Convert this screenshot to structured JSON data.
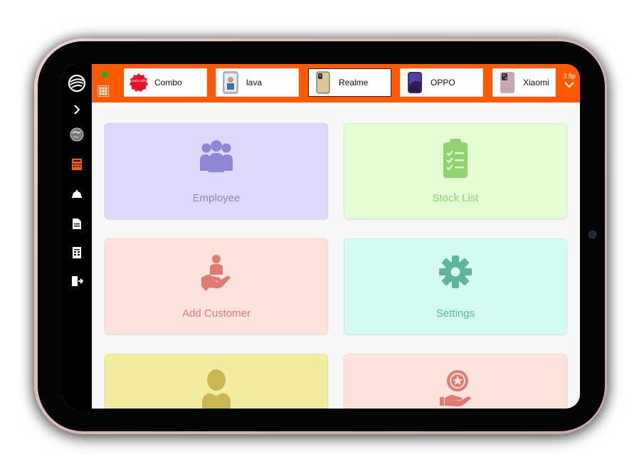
{
  "colors": {
    "topbar": "#ff5a00",
    "sidebar": "#000000",
    "status_online": "#22aa22"
  },
  "sidebar": {
    "items": [
      {
        "icon": "app-logo-icon"
      },
      {
        "icon": "chevron-right-icon"
      },
      {
        "icon": "globe-icon"
      },
      {
        "icon": "cash-register-icon"
      },
      {
        "icon": "cloche-icon"
      },
      {
        "icon": "document-icon"
      },
      {
        "icon": "receipt-icon"
      },
      {
        "icon": "logout-icon"
      }
    ]
  },
  "topbar": {
    "categories": [
      {
        "label": "Combo",
        "thumb_text": "Combo Offer!"
      },
      {
        "label": "lava"
      },
      {
        "label": "Realme",
        "selected": true
      },
      {
        "label": "OPPO"
      },
      {
        "label": "Xiaomi"
      }
    ],
    "more_label": "3.8p"
  },
  "tiles": [
    {
      "title": "Employee",
      "icon": "users-icon",
      "bg": "#dcd9fc",
      "fg": "#8f86d6"
    },
    {
      "title": "Stock List",
      "icon": "clipboard-checklist-icon",
      "bg": "#e3fcd3",
      "fg": "#8fd470"
    },
    {
      "title": "Add Customer",
      "icon": "hand-holding-person-icon",
      "bg": "#fde3db",
      "fg": "#e07a72"
    },
    {
      "title": "Settings",
      "icon": "gear-icon",
      "bg": "#d3fbf2",
      "fg": "#5fb49b"
    },
    {
      "title": "",
      "icon": "user-icon",
      "bg": "#f3ed9f",
      "fg": "#cbb852"
    },
    {
      "title": "",
      "icon": "hand-star-badge-icon",
      "bg": "#fde3db",
      "fg": "#e07a72"
    }
  ]
}
